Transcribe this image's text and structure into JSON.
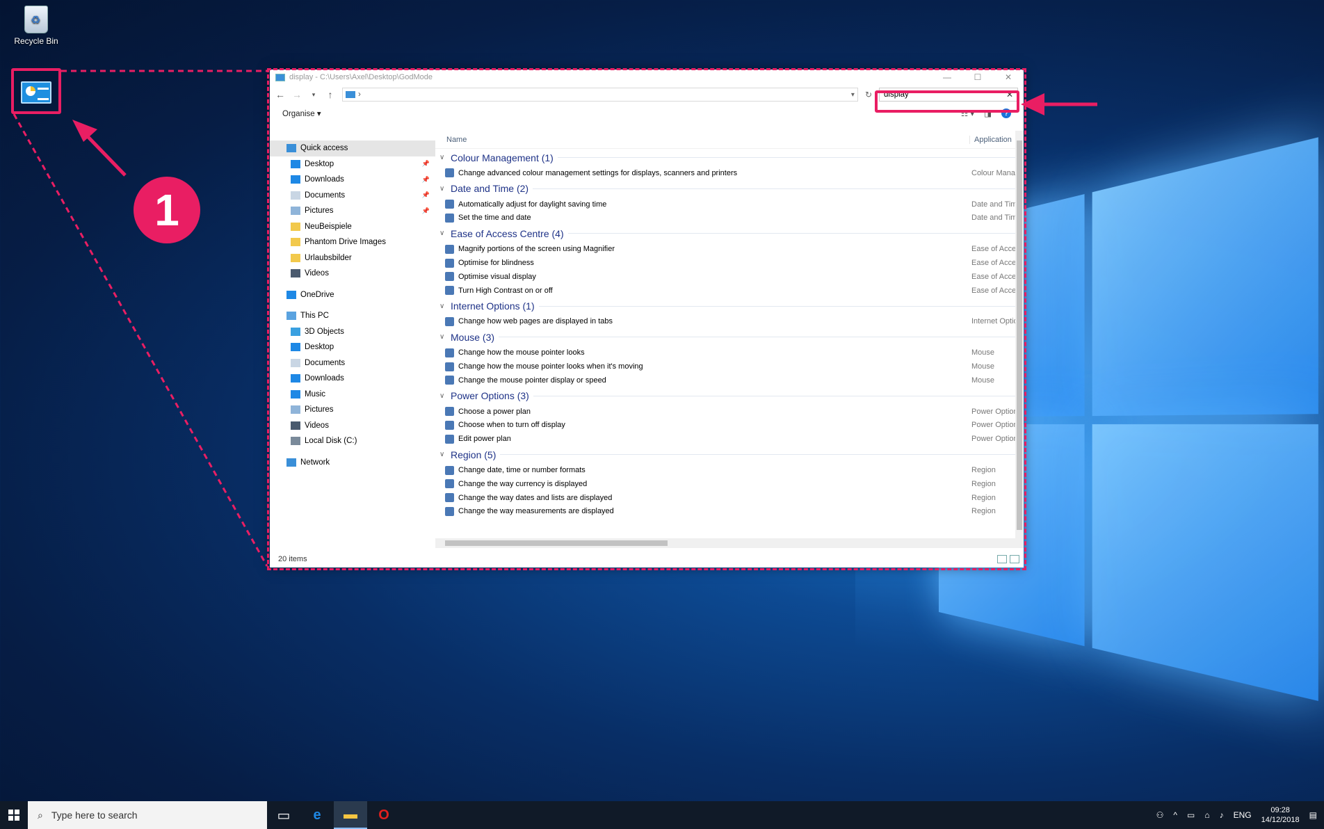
{
  "desktop": {
    "recycle_bin_label": "Recycle Bin",
    "annotation_number": "1"
  },
  "window": {
    "title": "display - C:\\Users\\Axel\\Desktop\\GodMode",
    "address_separator": "›",
    "search_value": "display",
    "organise_label": "Organise ▾",
    "status_text": "20 items",
    "columns": {
      "name": "Name",
      "application": "Application"
    }
  },
  "nav": {
    "quick_access": "Quick access",
    "quick_items": [
      "Desktop",
      "Downloads",
      "Documents",
      "Pictures",
      "NeuBeispiele",
      "Phantom Drive Images",
      "Urlaubsbilder",
      "Videos"
    ],
    "onedrive": "OneDrive",
    "this_pc": "This PC",
    "pc_items": [
      "3D Objects",
      "Desktop",
      "Documents",
      "Downloads",
      "Music",
      "Pictures",
      "Videos",
      "Local Disk (C:)"
    ],
    "network": "Network"
  },
  "groups": [
    {
      "title": "Colour Management (1)",
      "rows": [
        {
          "name": "Change advanced colour management settings for displays, scanners and printers",
          "app": "Colour Manag"
        }
      ]
    },
    {
      "title": "Date and Time (2)",
      "rows": [
        {
          "name": "Automatically adjust for daylight saving time",
          "app": "Date and Time"
        },
        {
          "name": "Set the time and date",
          "app": "Date and Time"
        }
      ]
    },
    {
      "title": "Ease of Access Centre (4)",
      "rows": [
        {
          "name": "Magnify portions of the screen using Magnifier",
          "app": "Ease of Access"
        },
        {
          "name": "Optimise for blindness",
          "app": "Ease of Access"
        },
        {
          "name": "Optimise visual display",
          "app": "Ease of Access"
        },
        {
          "name": "Turn High Contrast on or off",
          "app": "Ease of Access"
        }
      ]
    },
    {
      "title": "Internet Options (1)",
      "rows": [
        {
          "name": "Change how web pages are displayed in tabs",
          "app": "Internet Option"
        }
      ]
    },
    {
      "title": "Mouse (3)",
      "rows": [
        {
          "name": "Change how the mouse pointer looks",
          "app": "Mouse"
        },
        {
          "name": "Change how the mouse pointer looks when it's moving",
          "app": "Mouse"
        },
        {
          "name": "Change the mouse pointer display or speed",
          "app": "Mouse"
        }
      ]
    },
    {
      "title": "Power Options (3)",
      "rows": [
        {
          "name": "Choose a power plan",
          "app": "Power Options"
        },
        {
          "name": "Choose when to turn off display",
          "app": "Power Options"
        },
        {
          "name": "Edit power plan",
          "app": "Power Options"
        }
      ]
    },
    {
      "title": "Region (5)",
      "rows": [
        {
          "name": "Change date, time or number formats",
          "app": "Region"
        },
        {
          "name": "Change the way currency is displayed",
          "app": "Region"
        },
        {
          "name": "Change the way dates and lists are displayed",
          "app": "Region"
        },
        {
          "name": "Change the way measurements are displayed",
          "app": "Region"
        }
      ]
    }
  ],
  "taskbar": {
    "search_placeholder": "Type here to search",
    "language": "ENG",
    "time": "09:28",
    "date": "14/12/2018"
  },
  "colors": {
    "annotation": "#e91e63",
    "group_header": "#1e3287",
    "taskbar": "#101a28"
  }
}
